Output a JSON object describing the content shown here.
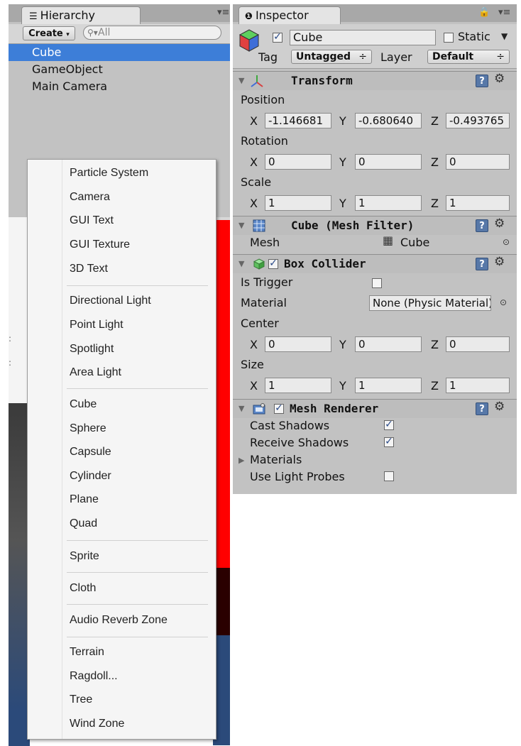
{
  "hierarchy": {
    "tab_title": "Hierarchy",
    "create_label": "Create",
    "search_placeholder": "All",
    "items": [
      "Cube",
      "GameObject",
      "Main Camera"
    ]
  },
  "context_menu": {
    "groups": [
      [
        "Particle System",
        "Camera",
        "GUI Text",
        "GUI Texture",
        "3D Text"
      ],
      [
        "Directional Light",
        "Point Light",
        "Spotlight",
        "Area Light"
      ],
      [
        "Cube",
        "Sphere",
        "Capsule",
        "Cylinder",
        "Plane",
        "Quad"
      ],
      [
        "Sprite"
      ],
      [
        "Cloth"
      ],
      [
        "Audio Reverb Zone"
      ],
      [
        "Terrain",
        "Ragdoll...",
        "Tree",
        "Wind Zone"
      ]
    ]
  },
  "inspector": {
    "tab_title": "Inspector",
    "object_name": "Cube",
    "object_active": true,
    "static_label": "Static",
    "static_checked": false,
    "tag_label": "Tag",
    "tag_value": "Untagged",
    "layer_label": "Layer",
    "layer_value": "Default",
    "transform": {
      "title": "Transform",
      "position_label": "Position",
      "position": {
        "x": "-1.146681",
        "y": "-0.680640",
        "z": "-0.493765"
      },
      "rotation_label": "Rotation",
      "rotation": {
        "x": "0",
        "y": "0",
        "z": "0"
      },
      "scale_label": "Scale",
      "scale": {
        "x": "1",
        "y": "1",
        "z": "1"
      }
    },
    "mesh_filter": {
      "title": "Cube (Mesh Filter)",
      "mesh_label": "Mesh",
      "mesh_value": "Cube"
    },
    "box_collider": {
      "title": "Box Collider",
      "enabled": true,
      "is_trigger_label": "Is Trigger",
      "is_trigger": false,
      "material_label": "Material",
      "material_value": "None (Physic Material)",
      "center_label": "Center",
      "center": {
        "x": "0",
        "y": "0",
        "z": "0"
      },
      "size_label": "Size",
      "size": {
        "x": "1",
        "y": "1",
        "z": "1"
      }
    },
    "mesh_renderer": {
      "title": "Mesh Renderer",
      "enabled": true,
      "cast_shadows_label": "Cast Shadows",
      "cast_shadows": true,
      "receive_shadows_label": "Receive Shadows",
      "receive_shadows": true,
      "materials_label": "Materials",
      "use_light_probes_label": "Use Light Probes",
      "use_light_probes": false
    },
    "axis_labels": {
      "x": "X",
      "y": "Y",
      "z": "Z"
    }
  },
  "colors": {
    "selection": "#3d7ed8",
    "panel": "#c2c2c2",
    "scene_red": "#ff0000",
    "scene_blue": "#2b4a7a"
  }
}
